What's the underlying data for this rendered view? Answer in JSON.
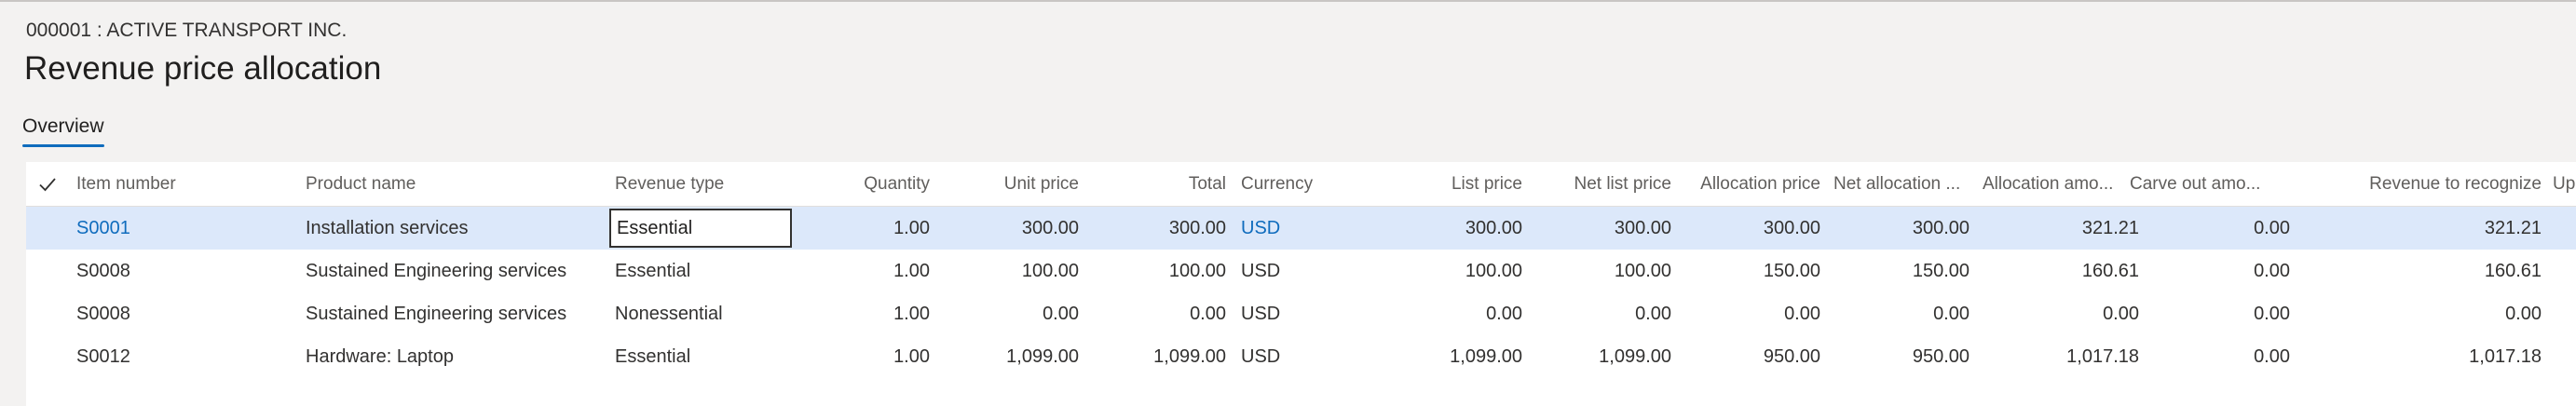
{
  "header": {
    "company": "000001 : ACTIVE TRANSPORT INC.",
    "title": "Revenue price allocation"
  },
  "tabs": [
    {
      "label": "Overview",
      "active": true
    }
  ],
  "grid": {
    "columns": [
      "Item number",
      "Product name",
      "Revenue type",
      "Quantity",
      "Unit price",
      "Total",
      "Currency",
      "List price",
      "Net list price",
      "Allocation price",
      "Net allocation ...",
      "Allocation amo...",
      "Carve out amo...",
      "Revenue to recognize",
      "Up"
    ],
    "rows": [
      [
        "S0001",
        "Installation services",
        "Essential",
        "1.00",
        "300.00",
        "300.00",
        "USD",
        "300.00",
        "300.00",
        "300.00",
        "300.00",
        "321.21",
        "0.00",
        "321.21"
      ],
      [
        "S0008",
        "Sustained Engineering services",
        "Essential",
        "1.00",
        "100.00",
        "100.00",
        "USD",
        "100.00",
        "100.00",
        "150.00",
        "150.00",
        "160.61",
        "0.00",
        "160.61"
      ],
      [
        "S0008",
        "Sustained Engineering services",
        "Nonessential",
        "1.00",
        "0.00",
        "0.00",
        "USD",
        "0.00",
        "0.00",
        "0.00",
        "0.00",
        "0.00",
        "0.00",
        "0.00"
      ],
      [
        "S0012",
        "Hardware: Laptop",
        "Essential",
        "1.00",
        "1,099.00",
        "1,099.00",
        "USD",
        "1,099.00",
        "1,099.00",
        "950.00",
        "950.00",
        "1,017.18",
        "0.00",
        "1,017.18"
      ]
    ],
    "selected_row": 0,
    "colors": {
      "selected_bg": "#dce8fa",
      "link": "#0f6cbd"
    }
  }
}
